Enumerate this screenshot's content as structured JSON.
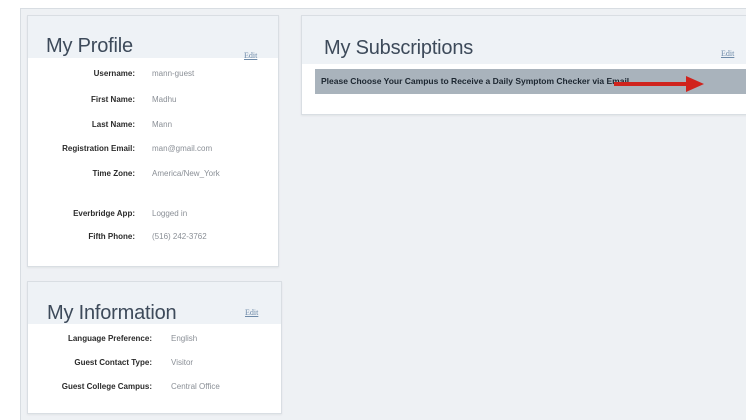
{
  "profile": {
    "title": "My Profile",
    "edit_label": "Edit",
    "fields": [
      {
        "label": "Username:",
        "value": "mann-guest"
      },
      {
        "label": "First Name:",
        "value": "Madhu"
      },
      {
        "label": "Last Name:",
        "value": "Mann"
      },
      {
        "label": "Registration Email:",
        "value": "man@gmail.com"
      },
      {
        "label": "Time Zone:",
        "value": "America/New_York"
      },
      {
        "label": "Everbridge App:",
        "value": "Logged in"
      },
      {
        "label": "Fifth Phone:",
        "value": "(516) 242-3762"
      }
    ]
  },
  "information": {
    "title": "My Information",
    "edit_label": "Edit",
    "fields": [
      {
        "label": "Language Preference:",
        "value": "English"
      },
      {
        "label": "Guest Contact Type:",
        "value": "Visitor"
      },
      {
        "label": "Guest College Campus:",
        "value": "Central Office"
      }
    ]
  },
  "subscriptions": {
    "title": "My Subscriptions",
    "edit_label": "Edit",
    "banner_text": "Please Choose Your Campus to Receive a Daily Symptom Checker via Email"
  },
  "colors": {
    "arrow": "#d0231d",
    "banner": "#a9b3bc",
    "page_bg": "#eef1f4"
  }
}
